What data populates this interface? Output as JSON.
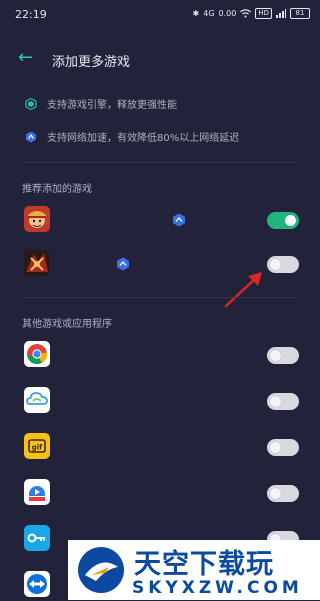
{
  "status_bar": {
    "time": "22:19",
    "network": "4G",
    "speed": "0.00",
    "hd": "HD",
    "battery": "81"
  },
  "header": {
    "title": "添加更多游戏"
  },
  "features": [
    {
      "text": "支持游戏引擎，释放更强性能",
      "icon": "engine-icon"
    },
    {
      "text": "支持网络加速，有效降低80%以上网络延迟",
      "icon": "accelerate-icon"
    }
  ],
  "sections": {
    "recommended": "推荐添加的游戏",
    "others": "其他游戏或应用程序"
  },
  "recommended_apps": [
    {
      "icon": "onepiece-game-icon",
      "enabled": true
    },
    {
      "icon": "warrior-game-icon",
      "enabled": false
    }
  ],
  "other_apps": [
    {
      "icon": "chrome-icon",
      "enabled": false
    },
    {
      "icon": "cloud-app-icon",
      "enabled": false
    },
    {
      "icon": "gif-app-icon",
      "enabled": false
    },
    {
      "icon": "video-app-icon",
      "enabled": false
    },
    {
      "icon": "key-app-icon",
      "enabled": false
    },
    {
      "icon": "teamviewer-icon",
      "enabled": false
    }
  ],
  "watermark": {
    "brand": "天空下载玩",
    "domain": "SKYXZW.COM"
  },
  "colors": {
    "background": "#22233a",
    "accent": "#34c6b5",
    "toggle_on": "#21b57d",
    "arrow": "#e02424",
    "watermark": "#0b4aa0"
  }
}
